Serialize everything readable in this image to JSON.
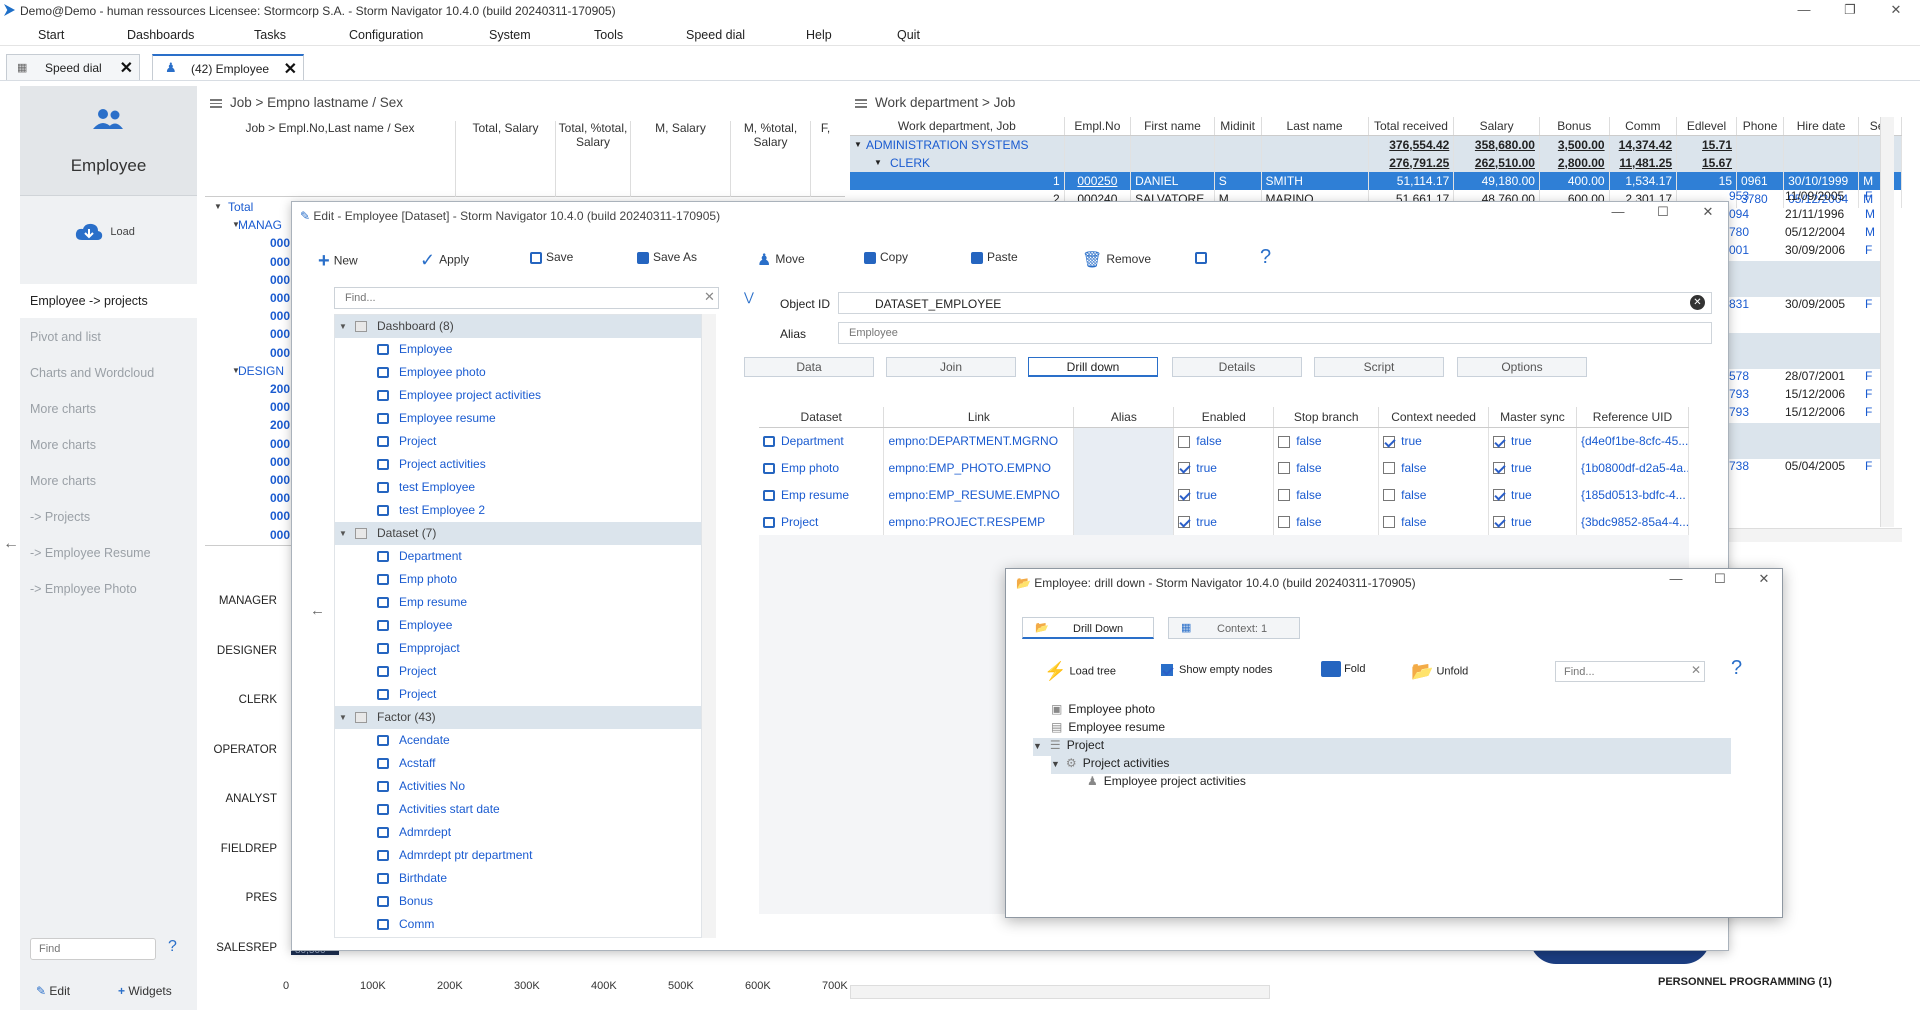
{
  "window": {
    "title": "Demo@Demo - human ressources   Licensee: Stormcorp S.A. -  Storm Navigator 10.4.0 (build 20240311-170905)"
  },
  "menu": [
    "Start",
    "Dashboards",
    "Tasks",
    "Configuration",
    "System",
    "Tools",
    "Speed dial",
    "Help",
    "Quit"
  ],
  "tabs": [
    {
      "label": "Speed dial"
    },
    {
      "label": "(42) Employee"
    }
  ],
  "leftnav": {
    "title": "Employee",
    "load": "Load",
    "items": [
      "Employee -> projects",
      "Pivot and list",
      "Charts and Wordcloud",
      "More charts",
      "More charts",
      "More charts",
      "-> Projects",
      "-> Employee Resume",
      "-> Employee Photo"
    ],
    "find_placeholder": "Find",
    "help": "?",
    "edit": "Edit",
    "widgets": "Widgets"
  },
  "pivot": {
    "title": "Job > Empno lastname / Sex",
    "cols": [
      "Job > Empl.No,Last name / Sex",
      "Total, Salary",
      "Total, %total, Salary",
      "M, Salary",
      "M, %total, Salary",
      "F,"
    ],
    "rows": [
      "Total",
      "MANAG",
      "000",
      "000",
      "000",
      "000",
      "000",
      "000",
      "000",
      "DESIGN",
      "200",
      "000",
      "200",
      "000",
      "000",
      "000",
      "000",
      "000",
      "000"
    ]
  },
  "chart": {
    "categories": [
      "MANAGER",
      "DESIGNER",
      "CLERK",
      "OPERATOR",
      "ANALYST",
      "FIELDREP",
      "PRES",
      "SALESREP"
    ],
    "xticks": [
      "0",
      "100K",
      "200K",
      "300K",
      "400K",
      "500K",
      "600K",
      "700K"
    ],
    "partial_value": "80,500"
  },
  "workdept": {
    "title": "Work department > Job",
    "cols": [
      "Work department, Job",
      "Empl.No",
      "First name",
      "Midinit",
      "Last name",
      "Total received",
      "Salary",
      "Bonus",
      "Comm",
      "Edlevel",
      "Phone",
      "Hire date",
      "Sex"
    ],
    "rows": [
      {
        "name": "ADMINISTRATION SYSTEMS",
        "total": "376,554.42",
        "salary": "358,680.00",
        "bonus": "3,500.00",
        "comm": "14,374.42",
        "ed": "15.71"
      },
      {
        "name": "CLERK",
        "total": "276,791.25",
        "salary": "262,510.00",
        "bonus": "2,800.00",
        "comm": "11,481.25",
        "ed": "15.67"
      },
      {
        "n": "1",
        "empno": "000250",
        "first": "DANIEL",
        "mid": "S",
        "last": "SMITH",
        "total": "51,114.17",
        "salary": "49,180.00",
        "bonus": "400.00",
        "comm": "1,534.17",
        "ed": "15",
        "phone": "0961",
        "hire": "30/10/1999",
        "sex": "M"
      },
      {
        "n": "2",
        "empno": "000240",
        "first": "SALVATORE",
        "mid": "M",
        "last": "MARINO",
        "total": "51,661.17",
        "salary": "48,760.00",
        "bonus": "600.00",
        "comm": "2,301.17",
        "ed": "",
        "phone": "3780",
        "hire": "05/12/2004",
        "sex": "M"
      }
    ],
    "extra": [
      {
        "phone": "953",
        "hire": "11/09/2005",
        "sex": "F"
      },
      {
        "phone": "094",
        "hire": "21/11/1996",
        "sex": "M"
      },
      {
        "phone": "780",
        "hire": "05/12/2004",
        "sex": "M"
      },
      {
        "phone": "001",
        "hire": "30/09/2006",
        "sex": "F"
      },
      {
        "phone": "831",
        "hire": "30/09/2005",
        "sex": "F"
      },
      {
        "phone": "578",
        "hire": "28/07/2001",
        "sex": "F"
      },
      {
        "phone": "793",
        "hire": "15/12/2006",
        "sex": "F"
      },
      {
        "phone": "793",
        "hire": "15/12/2006",
        "sex": "F"
      },
      {
        "phone": "738",
        "hire": "05/04/2005",
        "sex": "F"
      }
    ]
  },
  "edit": {
    "title": "Edit - Employee [Dataset] -  Storm Navigator 10.4.0 (build 20240311-170905)",
    "toolbar": [
      "New",
      "Apply",
      "Save",
      "Save As",
      "Move",
      "Copy",
      "Paste",
      "Remove"
    ],
    "find_placeholder": "Find...",
    "object_id_label": "Object ID",
    "object_id": "DATASET_EMPLOYEE",
    "alias_label": "Alias",
    "alias": "Employee",
    "subtabs": [
      "Data",
      "Join",
      "Drill down",
      "Details",
      "Script",
      "Options"
    ],
    "tree": [
      {
        "g": "Dashboard (8)"
      },
      {
        "l": "Employee"
      },
      {
        "l": "Employee photo"
      },
      {
        "l": "Employee project activities"
      },
      {
        "l": "Employee resume"
      },
      {
        "l": "Project"
      },
      {
        "l": "Project activities"
      },
      {
        "l": "test Employee"
      },
      {
        "l": "test Employee 2"
      },
      {
        "g": "Dataset (7)"
      },
      {
        "l": "Department"
      },
      {
        "l": "Emp photo"
      },
      {
        "l": "Emp resume"
      },
      {
        "l": "Employee"
      },
      {
        "l": "Empprojact"
      },
      {
        "l": "Project"
      },
      {
        "l": "Project"
      },
      {
        "g": "Factor (43)"
      },
      {
        "l": "Acendate"
      },
      {
        "l": "Acstaff"
      },
      {
        "l": "Activities No"
      },
      {
        "l": "Activities start date"
      },
      {
        "l": "Admrdept"
      },
      {
        "l": "Admrdept ptr department"
      },
      {
        "l": "Birthdate"
      },
      {
        "l": "Bonus"
      },
      {
        "l": "Comm"
      }
    ],
    "dd_cols": [
      "Dataset",
      "Link",
      "Alias",
      "Enabled",
      "Stop branch",
      "Context needed",
      "Master sync",
      "Reference UID"
    ],
    "dd_rows": [
      {
        "ds": "Department",
        "link": "empno:DEPARTMENT.MGRNO",
        "en": "false",
        "sb": "false",
        "cn": "true",
        "ms": "true",
        "uid": "{d4e0f1be-8cfc-45..."
      },
      {
        "ds": "Emp photo",
        "link": "empno:EMP_PHOTO.EMPNO",
        "en": "true",
        "sb": "false",
        "cn": "false",
        "ms": "true",
        "uid": "{1b0800df-d2a5-4a..."
      },
      {
        "ds": "Emp resume",
        "link": "empno:EMP_RESUME.EMPNO",
        "en": "true",
        "sb": "false",
        "cn": "false",
        "ms": "true",
        "uid": "{185d0513-bdfc-4..."
      },
      {
        "ds": "Project",
        "link": "empno:PROJECT.RESPEMP",
        "en": "true",
        "sb": "false",
        "cn": "false",
        "ms": "true",
        "uid": "{3bdc9852-85a4-4..."
      }
    ]
  },
  "drill": {
    "title": "Employee: drill down -  Storm Navigator 10.4.0 (build 20240311-170905)",
    "tabs": [
      "Drill Down",
      "Context: 1"
    ],
    "toolbar": [
      "Load tree",
      "Show empty nodes",
      "Fold",
      "Unfold"
    ],
    "find_placeholder": "Find...",
    "nodes": [
      "Employee photo",
      "Employee resume",
      "Project",
      "Project activities",
      "Employee project activities"
    ]
  },
  "bottom_label": "PERSONNEL PROGRAMMING (1)"
}
